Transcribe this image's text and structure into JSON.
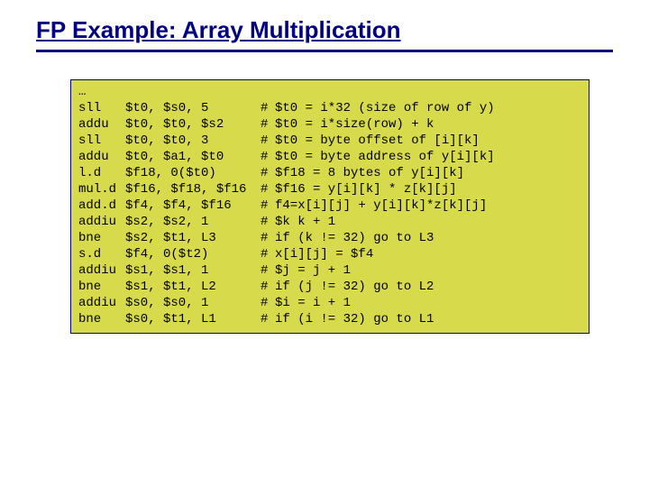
{
  "title": "FP Example: Array Multiplication",
  "ellipsis": "…",
  "lines": [
    {
      "instr": "sll",
      "args": "$t0, $s0, 5",
      "hash": "#",
      "comment": "$t0 = i*32 (size of row of y)"
    },
    {
      "instr": "addu",
      "args": "$t0, $t0, $s2",
      "hash": "#",
      "comment": "$t0 = i*size(row) + k"
    },
    {
      "instr": "sll",
      "args": "$t0, $t0, 3",
      "hash": "#",
      "comment": "$t0 = byte offset of [i][k]"
    },
    {
      "instr": "addu",
      "args": "$t0, $a1, $t0",
      "hash": "#",
      "comment": "$t0 = byte address of y[i][k]"
    },
    {
      "instr": "l.d",
      "args": "$f18, 0($t0)",
      "hash": "#",
      "comment": "$f18 = 8 bytes of y[i][k]"
    },
    {
      "instr": "mul.d",
      "args": "$f16, $f18, $f16",
      "hash": "#",
      "comment": "$f16 = y[i][k] * z[k][j]"
    },
    {
      "instr": "add.d",
      "args": "$f4, $f4, $f16",
      "hash": "#",
      "comment": "f4=x[i][j] + y[i][k]*z[k][j]"
    },
    {
      "instr": "addiu",
      "args": "$s2, $s2, 1",
      "hash": "#",
      "comment": "$k k + 1"
    },
    {
      "instr": "bne",
      "args": "$s2, $t1, L3",
      "hash": "#",
      "comment": "if (k != 32) go to L3"
    },
    {
      "instr": "s.d",
      "args": "$f4, 0($t2)",
      "hash": "#",
      "comment": "x[i][j] = $f4"
    },
    {
      "instr": "addiu",
      "args": "$s1, $s1, 1",
      "hash": "#",
      "comment": "$j = j + 1"
    },
    {
      "instr": "bne",
      "args": "$s1, $t1, L2",
      "hash": "#",
      "comment": "if (j != 32) go to L2"
    },
    {
      "instr": "addiu",
      "args": "$s0, $s0, 1",
      "hash": "#",
      "comment": "$i = i + 1"
    },
    {
      "instr": "bne",
      "args": "$s0, $t1, L1",
      "hash": "#",
      "comment": "if (i != 32) go to L1"
    }
  ]
}
